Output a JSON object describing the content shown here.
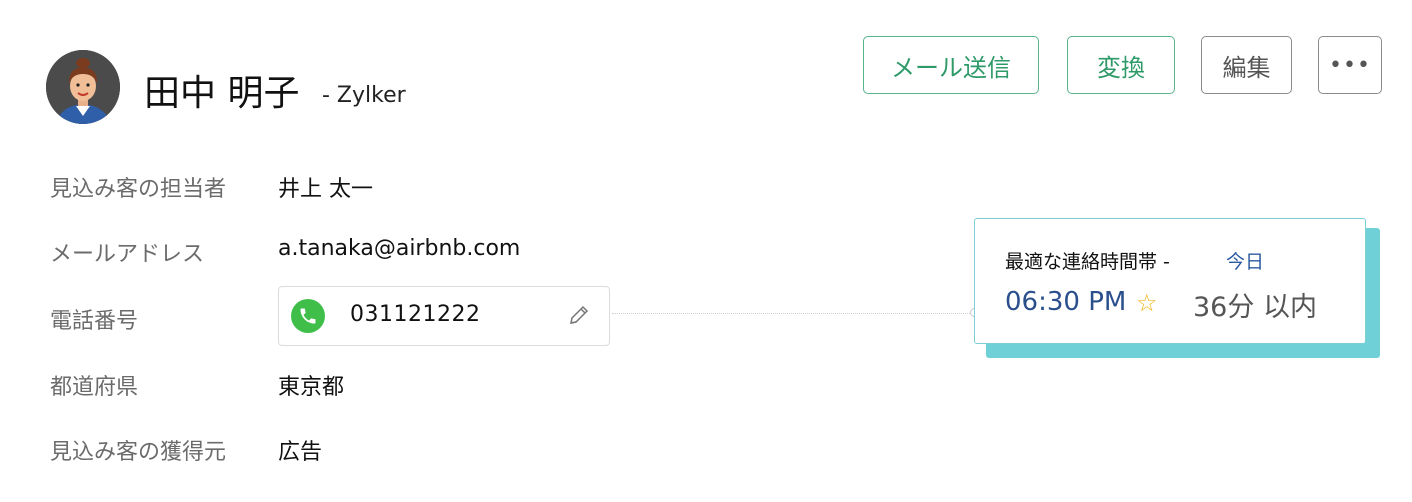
{
  "lead": {
    "name": "田中 明子",
    "company": "- Zylker"
  },
  "actions": {
    "send_mail": "メール送信",
    "convert": "変換",
    "edit": "編集",
    "more": "•••"
  },
  "fields": {
    "owner_label": "見込み客の担当者",
    "owner_value": "井上 太一",
    "email_label": "メールアドレス",
    "email_value": "a.tanaka@airbnb.com",
    "phone_label": "電話番号",
    "phone_value": "031121222",
    "prefecture_label": "都道府県",
    "prefecture_value": "東京都",
    "source_label": "見込み客の獲得元",
    "source_value": "広告"
  },
  "best_time": {
    "title": "最適な連絡時間帯 -",
    "day": "今日",
    "time": "06:30 PM",
    "star": "☆",
    "within": "36分 以内"
  },
  "icons": {
    "phone": "phone-icon",
    "edit": "pencil-icon",
    "avatar": "avatar-icon"
  },
  "colors": {
    "accent_green": "#2e9a68",
    "phone_green": "#3fbf4a",
    "card_border": "#7ccfd6",
    "time_blue": "#2b4f8c",
    "star": "#f0b41c"
  }
}
